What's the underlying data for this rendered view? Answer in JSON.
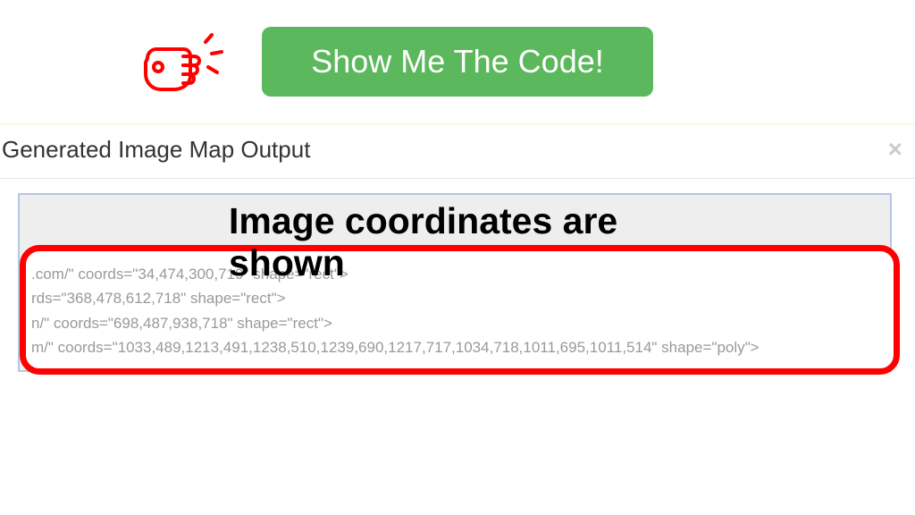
{
  "button": {
    "show_code_label": "Show Me The Code!"
  },
  "modal": {
    "title": "Generated Image Map Output",
    "close_symbol": "×"
  },
  "annotation": {
    "heading": "Image coordinates are shown"
  },
  "code_output": {
    "lines": [
      ".com/\" coords=\"34,474,300,719\" shape=\"rect\">",
      "rds=\"368,478,612,718\" shape=\"rect\">",
      "n/\" coords=\"698,487,938,718\" shape=\"rect\">",
      "m/\" coords=\"1033,489,1213,491,1238,510,1239,690,1217,717,1034,718,1011,695,1011,514\" shape=\"poly\">"
    ]
  }
}
